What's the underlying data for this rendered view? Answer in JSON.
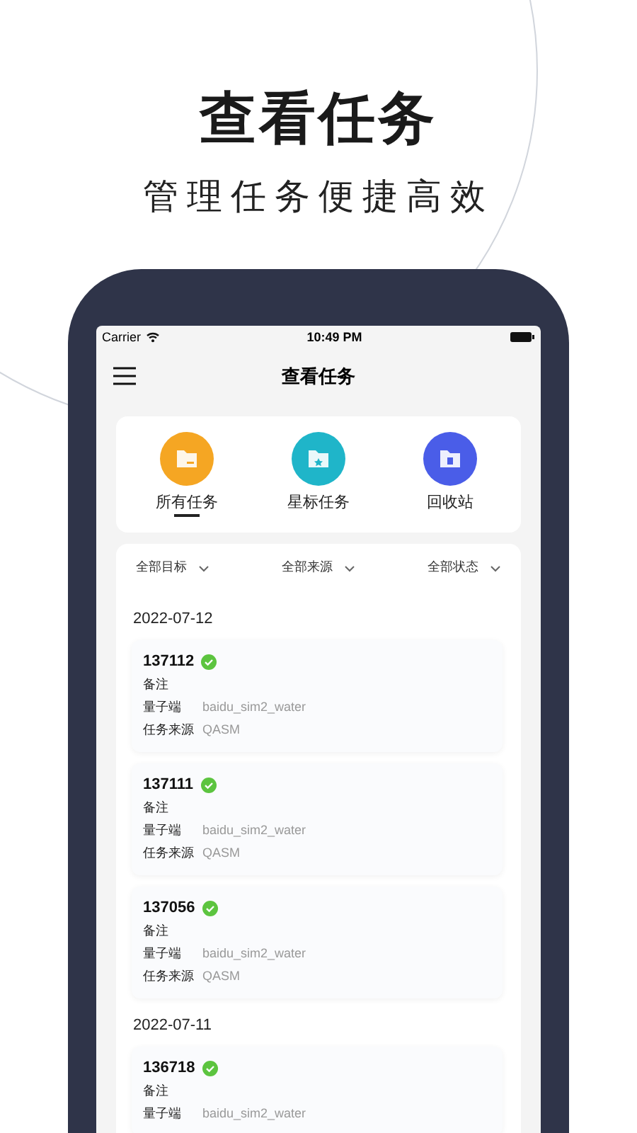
{
  "headline": "查看任务",
  "subheadline": "管理任务便捷高效",
  "status_bar": {
    "carrier": "Carrier",
    "time": "10:49 PM"
  },
  "nav": {
    "title": "查看任务"
  },
  "categories": [
    {
      "label": "所有任务",
      "selected": true,
      "color": "#f5a623"
    },
    {
      "label": "星标任务",
      "selected": false,
      "color": "#1fb5c9"
    },
    {
      "label": "回收站",
      "selected": false,
      "color": "#4a5de8"
    }
  ],
  "filters": [
    "全部目标",
    "全部来源",
    "全部状态"
  ],
  "groups": [
    {
      "date": "2022-07-12",
      "tasks": [
        {
          "id": "137112",
          "done": true,
          "note_label": "备注",
          "rows": [
            {
              "label": "量子端",
              "value": "baidu_sim2_water"
            },
            {
              "label": "任务来源",
              "value": "QASM"
            }
          ]
        },
        {
          "id": "137111",
          "done": true,
          "note_label": "备注",
          "rows": [
            {
              "label": "量子端",
              "value": "baidu_sim2_water"
            },
            {
              "label": "任务来源",
              "value": "QASM"
            }
          ]
        },
        {
          "id": "137056",
          "done": true,
          "note_label": "备注",
          "rows": [
            {
              "label": "量子端",
              "value": "baidu_sim2_water"
            },
            {
              "label": "任务来源",
              "value": "QASM"
            }
          ]
        }
      ]
    },
    {
      "date": "2022-07-11",
      "tasks": [
        {
          "id": "136718",
          "done": true,
          "note_label": "备注",
          "rows": [
            {
              "label": "量子端",
              "value": "baidu_sim2_water"
            }
          ]
        }
      ]
    }
  ]
}
